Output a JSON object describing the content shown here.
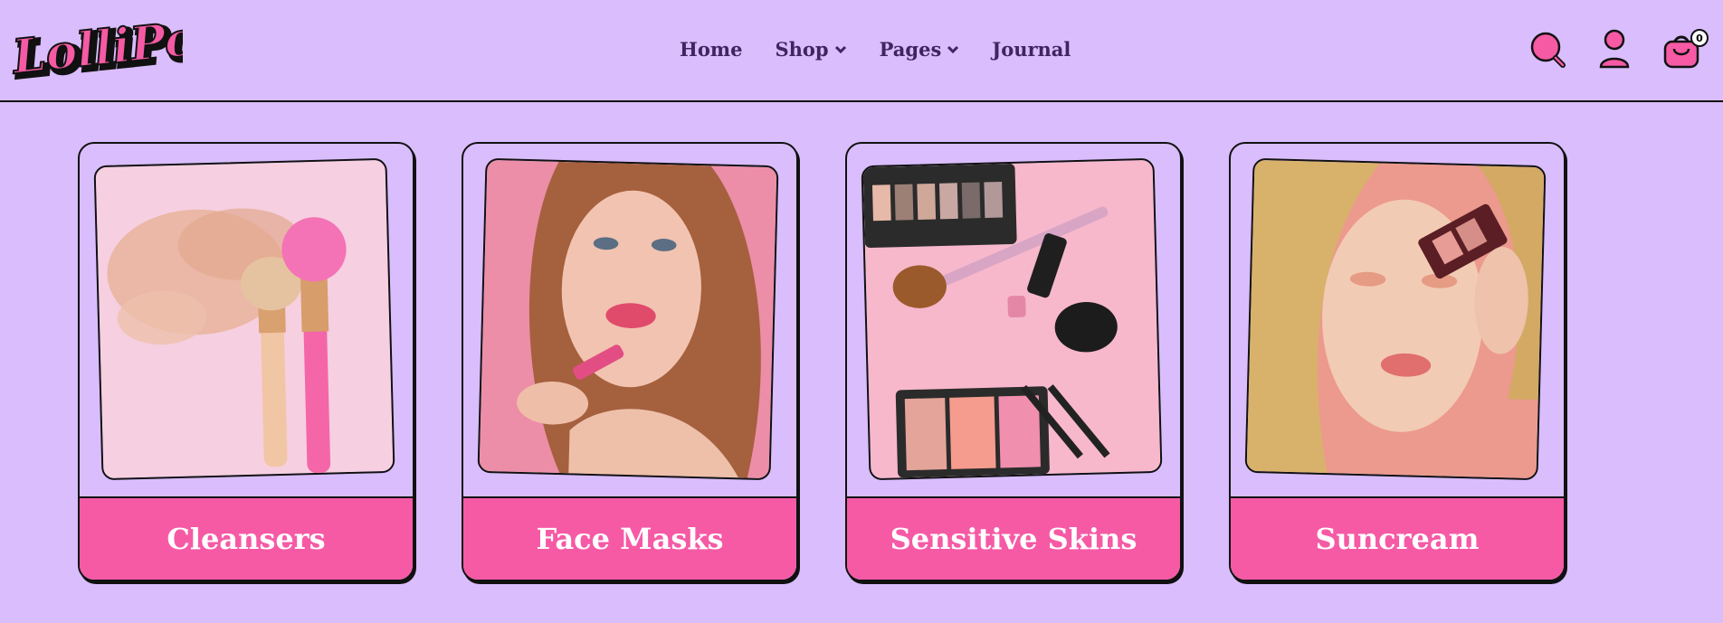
{
  "brand": {
    "logo_text": "LolliPop",
    "accent": "#f65aa5",
    "background": "#d9bdfd",
    "text_dark": "#3f2461"
  },
  "nav": {
    "items": [
      {
        "label": "Home",
        "has_dropdown": false
      },
      {
        "label": "Shop",
        "has_dropdown": true
      },
      {
        "label": "Pages",
        "has_dropdown": true
      },
      {
        "label": "Journal",
        "has_dropdown": false
      }
    ]
  },
  "header_icons": {
    "search": "search-icon",
    "account": "user-icon",
    "cart": "cart-icon",
    "cart_count": "0"
  },
  "cards": [
    {
      "label": "Cleansers",
      "image": "makeup-brushes-powder"
    },
    {
      "label": "Face Masks",
      "image": "woman-applying-lipstick"
    },
    {
      "label": "Sensitive Skins",
      "image": "makeup-products-flatlay"
    },
    {
      "label": "Suncream",
      "image": "woman-with-eyeshadow-palette"
    }
  ]
}
